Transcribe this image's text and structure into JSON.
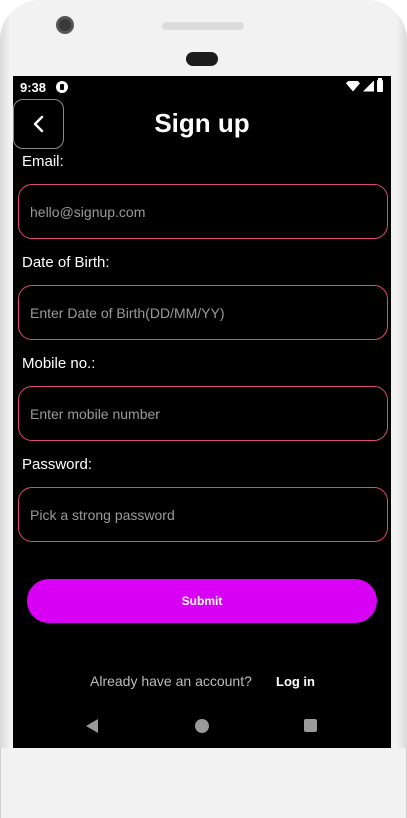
{
  "status_bar": {
    "time": "9:38"
  },
  "header": {
    "title": "Sign up"
  },
  "form": {
    "email": {
      "label": "Email:",
      "value": "hello@signup.com",
      "placeholder": ""
    },
    "dob": {
      "label": "Date of Birth:",
      "value": "",
      "placeholder": "Enter Date of Birth(DD/MM/YY)"
    },
    "mobile": {
      "label": "Mobile no.:",
      "value": "",
      "placeholder": "Enter mobile number"
    },
    "password": {
      "label": "Password:",
      "value": "",
      "placeholder": "Pick a strong password"
    },
    "submit_label": "Submit"
  },
  "footer": {
    "prompt": "Already have an account?",
    "login_label": "Log in"
  },
  "colors": {
    "background": "#000000",
    "field_border": "#e0487a",
    "submit": "#d800f5"
  },
  "icons": {
    "back": "chevron-left-icon",
    "wifi": "wifi-icon",
    "signal": "signal-icon",
    "battery": "battery-icon"
  }
}
